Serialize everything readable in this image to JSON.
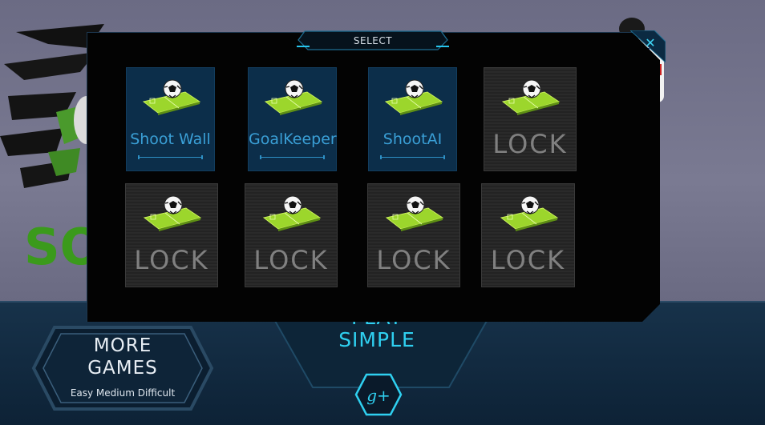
{
  "dialog": {
    "title": "SELECT",
    "close_glyph": "✕"
  },
  "modes": [
    {
      "label": "Shoot Wall",
      "locked": false
    },
    {
      "label": "GoalKeeper",
      "locked": false
    },
    {
      "label": "ShootAI",
      "locked": false
    },
    {
      "label": "LOCK",
      "locked": true
    },
    {
      "label": "LOCK",
      "locked": true
    },
    {
      "label": "LOCK",
      "locked": true
    },
    {
      "label": "LOCK",
      "locked": true
    },
    {
      "label": "LOCK",
      "locked": true
    }
  ],
  "more_games": {
    "line1": "MORE",
    "line2": "GAMES",
    "subtitle": "Easy Medium Difficult"
  },
  "play": {
    "line1": "PLAY",
    "line2": "SIMPLE"
  },
  "social": {
    "gplus_label": "g+"
  },
  "background": {
    "logo_fragment": "SO"
  },
  "colors": {
    "accent": "#2fd0f0",
    "tile_open": "#0c2e4a",
    "tile_label": "#3a9fd6",
    "lock_text": "#808080"
  }
}
